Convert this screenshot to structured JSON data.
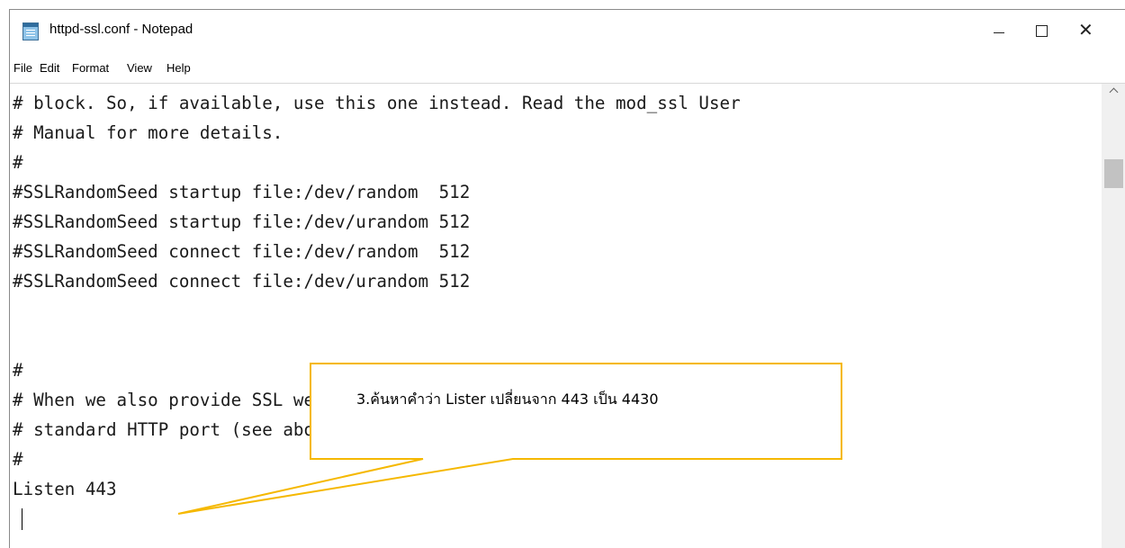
{
  "window": {
    "title": "httpd-ssl.conf - Notepad",
    "icon": "notepad-icon",
    "controls": {
      "minimize": "minimize-icon",
      "maximize": "maximize-icon",
      "close": "close-icon",
      "close_glyph": "✕"
    }
  },
  "menu": [
    "File",
    "Edit",
    "Format",
    "View",
    "Help"
  ],
  "editor": {
    "lines": [
      "# block. So, if available, use this one instead. Read the mod_ssl User",
      "# Manual for more details.",
      "#",
      "#SSLRandomSeed startup file:/dev/random  512",
      "#SSLRandomSeed startup file:/dev/urandom 512",
      "#SSLRandomSeed connect file:/dev/random  512",
      "#SSLRandomSeed connect file:/dev/urandom 512",
      "",
      "",
      "#",
      "# When we also provide SSL we have to listen to the",
      "# standard HTTP port (see above) and to the HTTPS port",
      "#",
      "Listen 443"
    ]
  },
  "callout": {
    "text": "3.ค้นหาคำว่า Lister เปลี่ยนจาก 443 เป็น 4430",
    "border_color": "#f5b800"
  }
}
